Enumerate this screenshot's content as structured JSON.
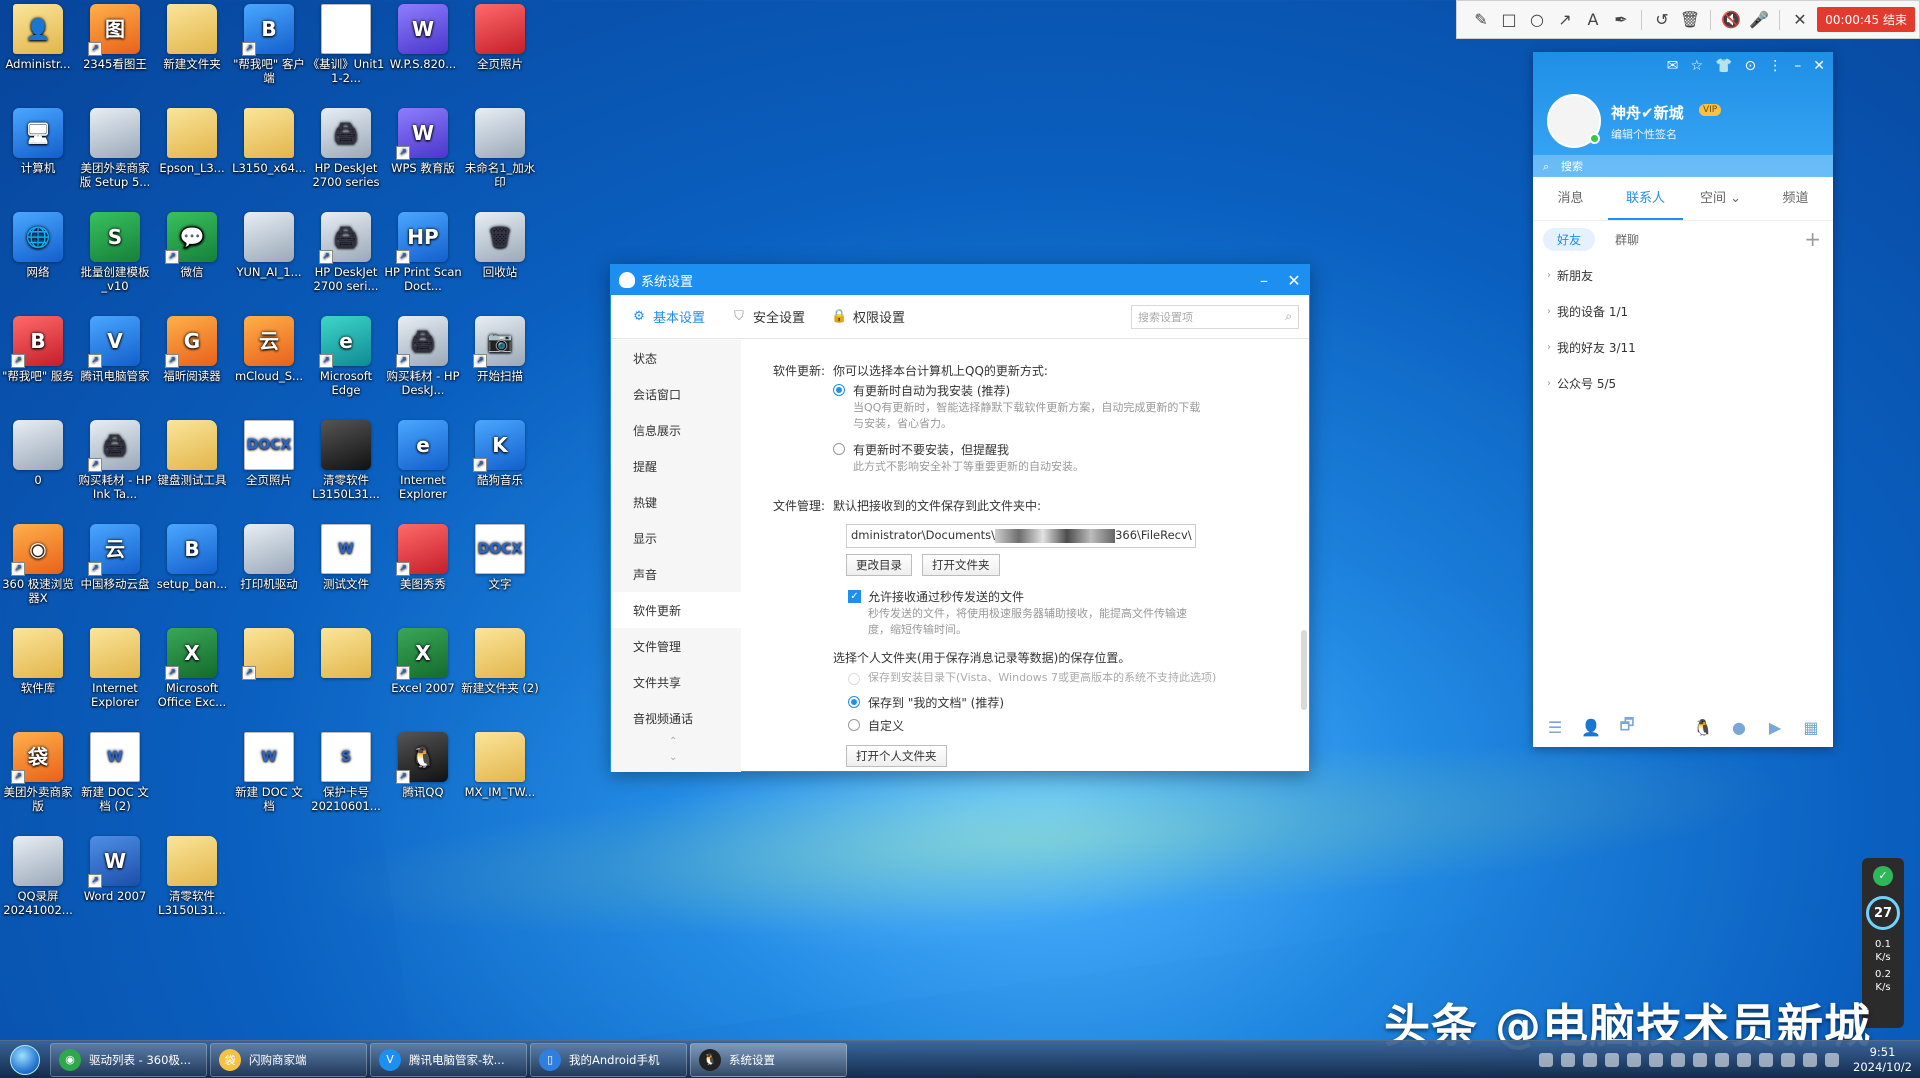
{
  "desktop": {
    "icons": [
      {
        "label": "Administr...",
        "glyph": "👤",
        "style": "folder",
        "shortcut": false
      },
      {
        "label": "2345看图王",
        "glyph": "图",
        "style": "orange",
        "shortcut": true
      },
      {
        "label": "新建文件夹",
        "glyph": "",
        "style": "folder",
        "shortcut": false
      },
      {
        "label": "\"帮我吧\" 客户端",
        "glyph": "B",
        "style": "blue",
        "shortcut": true
      },
      {
        "label": "《基训》Unit1 1-2...",
        "glyph": "",
        "style": "doc",
        "shortcut": false
      },
      {
        "label": "W.P.S.820...",
        "glyph": "W",
        "style": "purple",
        "shortcut": false
      },
      {
        "label": "全页照片",
        "glyph": "",
        "style": "red",
        "shortcut": false
      },
      {
        "label": "计算机",
        "glyph": "🖥",
        "style": "blue",
        "shortcut": false
      },
      {
        "label": "美团外卖商家版 Setup 5...",
        "glyph": "",
        "style": "grey",
        "shortcut": false
      },
      {
        "label": "Epson_L3...",
        "glyph": "",
        "style": "folder",
        "shortcut": false
      },
      {
        "label": "L3150_x64...",
        "glyph": "",
        "style": "folder",
        "shortcut": false
      },
      {
        "label": "HP DeskJet 2700 series",
        "glyph": "🖨",
        "style": "grey",
        "shortcut": false
      },
      {
        "label": "WPS 教育版",
        "glyph": "W",
        "style": "purple",
        "shortcut": true
      },
      {
        "label": "未命名1_加水印",
        "glyph": "",
        "style": "grey",
        "shortcut": false
      },
      {
        "label": "网络",
        "glyph": "🌐",
        "style": "blue",
        "shortcut": false
      },
      {
        "label": "批量创建模板_v10",
        "glyph": "S",
        "style": "green",
        "shortcut": false
      },
      {
        "label": "微信",
        "glyph": "💬",
        "style": "green",
        "shortcut": true
      },
      {
        "label": "YUN_AI_1...",
        "glyph": "",
        "style": "grey",
        "shortcut": false
      },
      {
        "label": "HP DeskJet 2700 seri...",
        "glyph": "🖨",
        "style": "grey",
        "shortcut": true
      },
      {
        "label": "HP Print Scan Doct...",
        "glyph": "HP",
        "style": "blue",
        "shortcut": true
      },
      {
        "label": "回收站",
        "glyph": "🗑",
        "style": "grey",
        "shortcut": false
      },
      {
        "label": "\"帮我吧\" 服务",
        "glyph": "B",
        "style": "red",
        "shortcut": true
      },
      {
        "label": "腾讯电脑管家",
        "glyph": "V",
        "style": "blue",
        "shortcut": true
      },
      {
        "label": "福昕阅读器",
        "glyph": "G",
        "style": "orange",
        "shortcut": true
      },
      {
        "label": "mCloud_S...",
        "glyph": "云",
        "style": "orange",
        "shortcut": false
      },
      {
        "label": "Microsoft Edge",
        "glyph": "e",
        "style": "teal",
        "shortcut": true
      },
      {
        "label": "购买耗材 - HP DeskJ...",
        "glyph": "🖨",
        "style": "grey",
        "shortcut": true
      },
      {
        "label": "开始扫描",
        "glyph": "📷",
        "style": "grey",
        "shortcut": true
      },
      {
        "label": "0",
        "glyph": "",
        "style": "grey",
        "shortcut": false
      },
      {
        "label": "购买耗材 - HP Ink Ta...",
        "glyph": "🖨",
        "style": "grey",
        "shortcut": true
      },
      {
        "label": "键盘测试工具",
        "glyph": "",
        "style": "folder",
        "shortcut": false
      },
      {
        "label": "全页照片",
        "glyph": "DOCX",
        "style": "doc",
        "shortcut": false
      },
      {
        "label": "清零软件 L3150L31...",
        "glyph": "",
        "style": "dark",
        "shortcut": false
      },
      {
        "label": "Internet Explorer",
        "glyph": "e",
        "style": "blue",
        "shortcut": false
      },
      {
        "label": "酷狗音乐",
        "glyph": "K",
        "style": "blue",
        "shortcut": true
      },
      {
        "label": "360 极速浏览器X",
        "glyph": "◉",
        "style": "orange",
        "shortcut": true
      },
      {
        "label": "中国移动云盘",
        "glyph": "云",
        "style": "blue",
        "shortcut": true
      },
      {
        "label": "setup_ban...",
        "glyph": "B",
        "style": "blue",
        "shortcut": false
      },
      {
        "label": "打印机驱动",
        "glyph": "",
        "style": "grey",
        "shortcut": false
      },
      {
        "label": "测试文件",
        "glyph": "W",
        "style": "doc",
        "shortcut": false
      },
      {
        "label": "美图秀秀",
        "glyph": "",
        "style": "red",
        "shortcut": true
      },
      {
        "label": "文字",
        "glyph": "DOCX",
        "style": "doc",
        "shortcut": false
      },
      {
        "label": "软件库",
        "glyph": "",
        "style": "folder",
        "shortcut": false
      },
      {
        "label": "Internet Explorer",
        "glyph": "",
        "style": "folder",
        "shortcut": false
      },
      {
        "label": "Microsoft Office Exc...",
        "glyph": "X",
        "style": "excel",
        "shortcut": true
      },
      {
        "label": "",
        "glyph": "",
        "style": "folder",
        "shortcut": true
      },
      {
        "label": "",
        "glyph": "",
        "style": "folder",
        "shortcut": false
      },
      {
        "label": "Excel 2007",
        "glyph": "X",
        "style": "excel",
        "shortcut": true
      },
      {
        "label": "新建文件夹 (2)",
        "glyph": "",
        "style": "folder",
        "shortcut": false
      },
      {
        "label": "美团外卖商家版",
        "glyph": "袋",
        "style": "orange",
        "shortcut": true
      },
      {
        "label": "新建 DOC 文档 (2)",
        "glyph": "W",
        "style": "doc",
        "shortcut": false
      },
      {
        "label": "",
        "glyph": "",
        "style": "none",
        "shortcut": false
      },
      {
        "label": "新建 DOC 文档",
        "glyph": "W",
        "style": "doc",
        "shortcut": false
      },
      {
        "label": "保护卡号 20210601...",
        "glyph": "S",
        "style": "doc",
        "shortcut": false
      },
      {
        "label": "腾讯QQ",
        "glyph": "🐧",
        "style": "dark",
        "shortcut": true
      },
      {
        "label": "MX_IM_TW...",
        "glyph": "",
        "style": "folder",
        "shortcut": false
      },
      {
        "label": "QQ录屏 20241002...",
        "glyph": "",
        "style": "grey",
        "shortcut": false
      },
      {
        "label": "Word 2007",
        "glyph": "W",
        "style": "word",
        "shortcut": true
      },
      {
        "label": "清零软件 L3150L31...",
        "glyph": "",
        "style": "folder",
        "shortcut": false
      }
    ]
  },
  "recorder": {
    "tools": [
      "✎",
      "□",
      "○",
      "↗",
      "A",
      "✒",
      "↺",
      "🗑",
      "🔇",
      "🎤",
      "✕"
    ],
    "timer": "00:00:45 结束"
  },
  "dialog": {
    "title": "系统设置",
    "minimize": "–",
    "close": "✕",
    "tabs": [
      {
        "label": "基本设置",
        "icon": "⚙",
        "active": true
      },
      {
        "label": "安全设置",
        "icon": "⛉",
        "active": false
      },
      {
        "label": "权限设置",
        "icon": "🔒",
        "active": false
      }
    ],
    "search_placeholder": "搜索设置项",
    "side": [
      "状态",
      "会话窗口",
      "信息展示",
      "提醒",
      "热键",
      "显示",
      "声音",
      "软件更新",
      "文件管理",
      "文件共享",
      "音视频通话"
    ],
    "active_side": 7,
    "update": {
      "label": "软件更新:",
      "intro": "你可以选择本台计算机上QQ的更新方式:",
      "opt1": "有更新时自动为我安装 (推荐)",
      "opt1_hint1": "当QQ有更新时，智能选择静默下载软件更新方案，自动完成更新的下载",
      "opt1_hint2": "与安装，省心省力。",
      "opt2": "有更新时不要安装，但提醒我",
      "opt2_hint": "此方式不影响安全补丁等重要更新的自动安装。"
    },
    "files": {
      "label": "文件管理:",
      "intro": "默认把接收到的文件保存到此文件夹中:",
      "path_prefix": "dministrator\\Documents\\",
      "path_suffix": "366\\FileRecv\\",
      "change_dir": "更改目录",
      "open_folder": "打开文件夹",
      "allow_flash": "允许接收通过秒传发送的文件",
      "flash_hint1": "秒传发送的文件，将使用极速服务器辅助接收，能提高文件传输速",
      "flash_hint2": "度，缩短传输时间。",
      "personal_intro": "选择个人文件夹(用于保存消息记录等数据)的保存位置。",
      "p_opt1": "保存到安装目录下(Vista、Windows 7或更高版本的系统不支持此选项)",
      "p_opt2": "保存到 \"我的文档\" (推荐)",
      "p_opt3": "自定义",
      "open_personal": "打开个人文件夹"
    },
    "scroll_up": "⌃",
    "scroll_down": "⌄"
  },
  "qq": {
    "top_icons": [
      "✉",
      "☆",
      "👕",
      "⊙",
      "⋮",
      "–",
      "✕"
    ],
    "nickname": "神舟✔新城",
    "vip": "VIP",
    "signature": "编辑个性签名",
    "search": "搜索",
    "tabs": [
      "消息",
      "联系人",
      "空间 ⌄",
      "频道"
    ],
    "active_tab": 1,
    "sub": [
      "好友",
      "群聊"
    ],
    "plus": "+",
    "groups": [
      "新朋友",
      "我的设备 1/1",
      "我的好友 3/11",
      "公众号 5/5"
    ],
    "bottom_icons": [
      "☰",
      "👤",
      "🗗",
      "🐧",
      "●",
      "▶",
      "▦"
    ]
  },
  "widget": {
    "shield": "✓",
    "percent": "27",
    "up": "0.1",
    "down": "0.2",
    "unit": "K/s"
  },
  "watermark": "头条 @电脑技术员新城",
  "taskbar": {
    "items": [
      {
        "label": "驱动列表 - 360极...",
        "icon_color": "#2ea84a",
        "glyph": "◉"
      },
      {
        "label": "闪购商家端",
        "icon_color": "#f7c244",
        "glyph": "袋"
      },
      {
        "label": "腾讯电脑管家-软...",
        "icon_color": "#1d8ff0",
        "glyph": "V"
      },
      {
        "label": "我的Android手机",
        "icon_color": "#2f7fe0",
        "glyph": "▯"
      },
      {
        "label": "系统设置",
        "icon_color": "#222222",
        "glyph": "🐧"
      }
    ],
    "active_index": 4,
    "time": "9:51",
    "date": "2024/10/2"
  }
}
